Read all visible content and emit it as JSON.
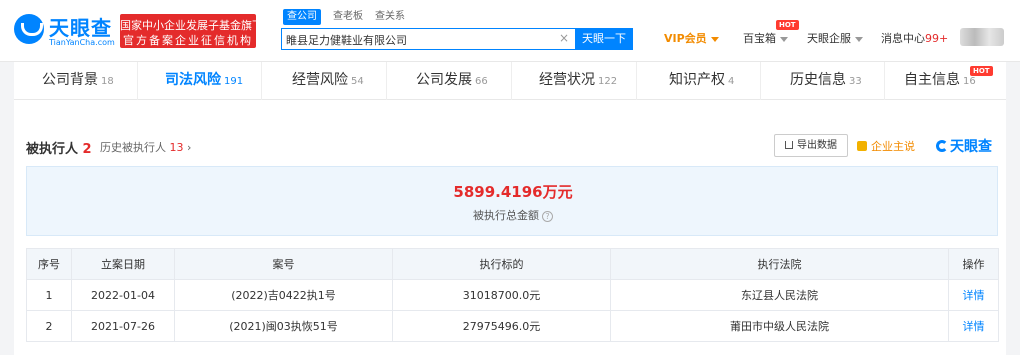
{
  "header": {
    "logo": {
      "name": "天眼查",
      "domain": "TianYanCha.com"
    },
    "badge": {
      "line1": "国家中小企业发展子基金旗下",
      "line2": "官方备案企业征信机构"
    },
    "search_tabs": [
      "查公司",
      "查老板",
      "查关系"
    ],
    "search": {
      "value": "睢县足力健鞋业有限公司",
      "button": "天眼一下",
      "clear": "×"
    },
    "nav": {
      "vip": "VIP会员",
      "box": "百宝箱",
      "enterprise": "天眼企服",
      "messages": "消息中心",
      "message_count": "99+",
      "hot": "HOT"
    }
  },
  "tabs": [
    {
      "label": "公司背景",
      "count": "18"
    },
    {
      "label": "司法风险",
      "count": "191"
    },
    {
      "label": "经营风险",
      "count": "54"
    },
    {
      "label": "公司发展",
      "count": "66"
    },
    {
      "label": "经营状况",
      "count": "122"
    },
    {
      "label": "知识产权",
      "count": "4"
    },
    {
      "label": "历史信息",
      "count": "33"
    },
    {
      "label": "自主信息",
      "count": "16"
    }
  ],
  "section": {
    "title": "被执行人",
    "count": "2",
    "history_label": "历史被执行人",
    "history_count": "13",
    "history_arrow": "›",
    "export": "导出数据",
    "owner": "企业主说",
    "brand": "天眼查"
  },
  "summary": {
    "amount": "5899.4196万元",
    "label": "被执行总金额",
    "help": "?"
  },
  "table": {
    "headers": [
      "序号",
      "立案日期",
      "案号",
      "执行标的",
      "执行法院",
      "操作"
    ],
    "rows": [
      {
        "no": "1",
        "date": "2022-01-04",
        "case": "(2022)吉0422执1号",
        "amount": "31018700.0元",
        "court": "东辽县人民法院",
        "action": "详情"
      },
      {
        "no": "2",
        "date": "2021-07-26",
        "case": "(2021)闽03执恢51号",
        "amount": "27975496.0元",
        "court": "莆田市中级人民法院",
        "action": "详情"
      }
    ]
  }
}
